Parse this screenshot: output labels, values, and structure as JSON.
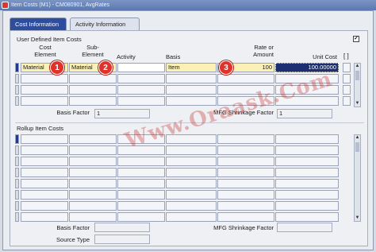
{
  "window": {
    "title": "Item Costs (M1) - CM080901, AvgRates",
    "app_icon": "oracle-app-icon"
  },
  "tabs": [
    {
      "label": "Cost Information",
      "active": true
    },
    {
      "label": "Activity Information",
      "active": false
    }
  ],
  "user_defined": {
    "section_label": "User Defined Item Costs",
    "headers": {
      "cost_element": "Cost\nElement",
      "sub_element": "Sub-\nElement",
      "activity": "Activity",
      "basis": "Basis",
      "rate_or_amount": "Rate or\nAmount",
      "unit_cost": "Unit Cost",
      "bracket": "[ ]"
    },
    "rows": [
      {
        "cost_element": "Material",
        "sub_element": "Material",
        "activity": "",
        "basis": "Item",
        "rate_or_amount": "100",
        "unit_cost": "100.00000"
      },
      {
        "cost_element": "",
        "sub_element": "",
        "activity": "",
        "basis": "",
        "rate_or_amount": "",
        "unit_cost": ""
      },
      {
        "cost_element": "",
        "sub_element": "",
        "activity": "",
        "basis": "",
        "rate_or_amount": "",
        "unit_cost": ""
      },
      {
        "cost_element": "",
        "sub_element": "",
        "activity": "",
        "basis": "",
        "rate_or_amount": "",
        "unit_cost": ""
      }
    ],
    "basis_factor_label": "Basis Factor",
    "basis_factor_value": "1",
    "mfg_shrinkage_label": "MFG Shrinkage Factor",
    "mfg_shrinkage_value": "1",
    "checkbox_mark": "✓"
  },
  "rollup": {
    "section_label": "Rollup Item Costs",
    "basis_factor_label": "Basis Factor",
    "basis_factor_value": "",
    "mfg_shrinkage_label": "MFG Shrinkage Factor",
    "mfg_shrinkage_value": "",
    "source_type_label": "Source Type",
    "source_type_value": ""
  },
  "callouts": [
    "1",
    "2",
    "3"
  ],
  "watermark": "Www.Oraask.Com",
  "colors": {
    "active_tab": "#2f4d9d",
    "required_field": "#fbf1b7",
    "selected_cell": "#1c2f73",
    "callout": "#e0322b"
  }
}
